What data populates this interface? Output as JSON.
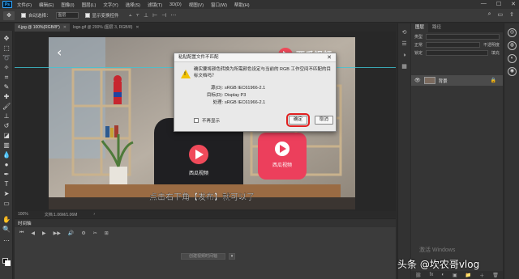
{
  "menubar": {
    "logo": "Ps",
    "items": [
      "文件(F)",
      "编辑(E)",
      "图像(I)",
      "图层(L)",
      "文字(Y)",
      "选择(S)",
      "滤镜(T)",
      "3D(D)",
      "视图(V)",
      "窗口(W)",
      "帮助(H)"
    ],
    "win_min": "—",
    "win_max": "☐",
    "win_close": "✕"
  },
  "options": {
    "auto_select_label": "自动选择：",
    "auto_select_value": "图层",
    "show_transform_label": "显示变换控件"
  },
  "tabs": [
    {
      "label": "4.jpg @ 100%(RGB/8*)",
      "active": true
    },
    {
      "label": "logo.gif @ 200% (图层 3, RGB/8)",
      "active": false
    }
  ],
  "photo": {
    "brand_top": "西瓜视频",
    "brand_shirt": "西瓜视频",
    "brand_pillow": "西瓜视频",
    "subtitle": "点击右下角【发布】就可以了"
  },
  "status": {
    "zoom": "100%",
    "doc": "文档:1.06M/1.06M",
    "arrow": "›"
  },
  "timeline": {
    "title": "时间轴",
    "create_label": "创建视频时间轴",
    "controls": [
      "⏮",
      "◀",
      "▶",
      "▶▶",
      "🔊",
      "⚙",
      "✂",
      "⊞"
    ]
  },
  "layers": {
    "tabs": [
      "图层",
      "路径"
    ],
    "kind_label": "类型",
    "mode_label": "正常",
    "opacity_label": "不透明度",
    "lock_label": "锁定",
    "fill_label": "填充",
    "layer_name": "背景",
    "footer_icons": [
      "⛓",
      "fx",
      "◐",
      "▣",
      "📁",
      "＋",
      "🗑"
    ]
  },
  "activate_text": "激活 Windows",
  "dialog": {
    "title": "粘贴配置文件不匹配",
    "close": "✕",
    "message": "确实要将颜色转换为所需颜色设定与当前的 RGB 工作空间不匹配的目标文档吗？",
    "rows": [
      {
        "key": "源(O):",
        "value": "sRGB IEC61966-2.1"
      },
      {
        "key": "目标(D):",
        "value": "Display P3"
      },
      {
        "key": "处理:",
        "value": "sRGB IEC61966-2.1"
      }
    ],
    "dont_show": "不再显示",
    "ok": "确定",
    "cancel": "取消"
  },
  "credit": "头条 @坎农哥vlog",
  "colors": {
    "accent_red": "#e02020",
    "guide": "#3fc6d4",
    "brand_red": "#f04a5a"
  }
}
